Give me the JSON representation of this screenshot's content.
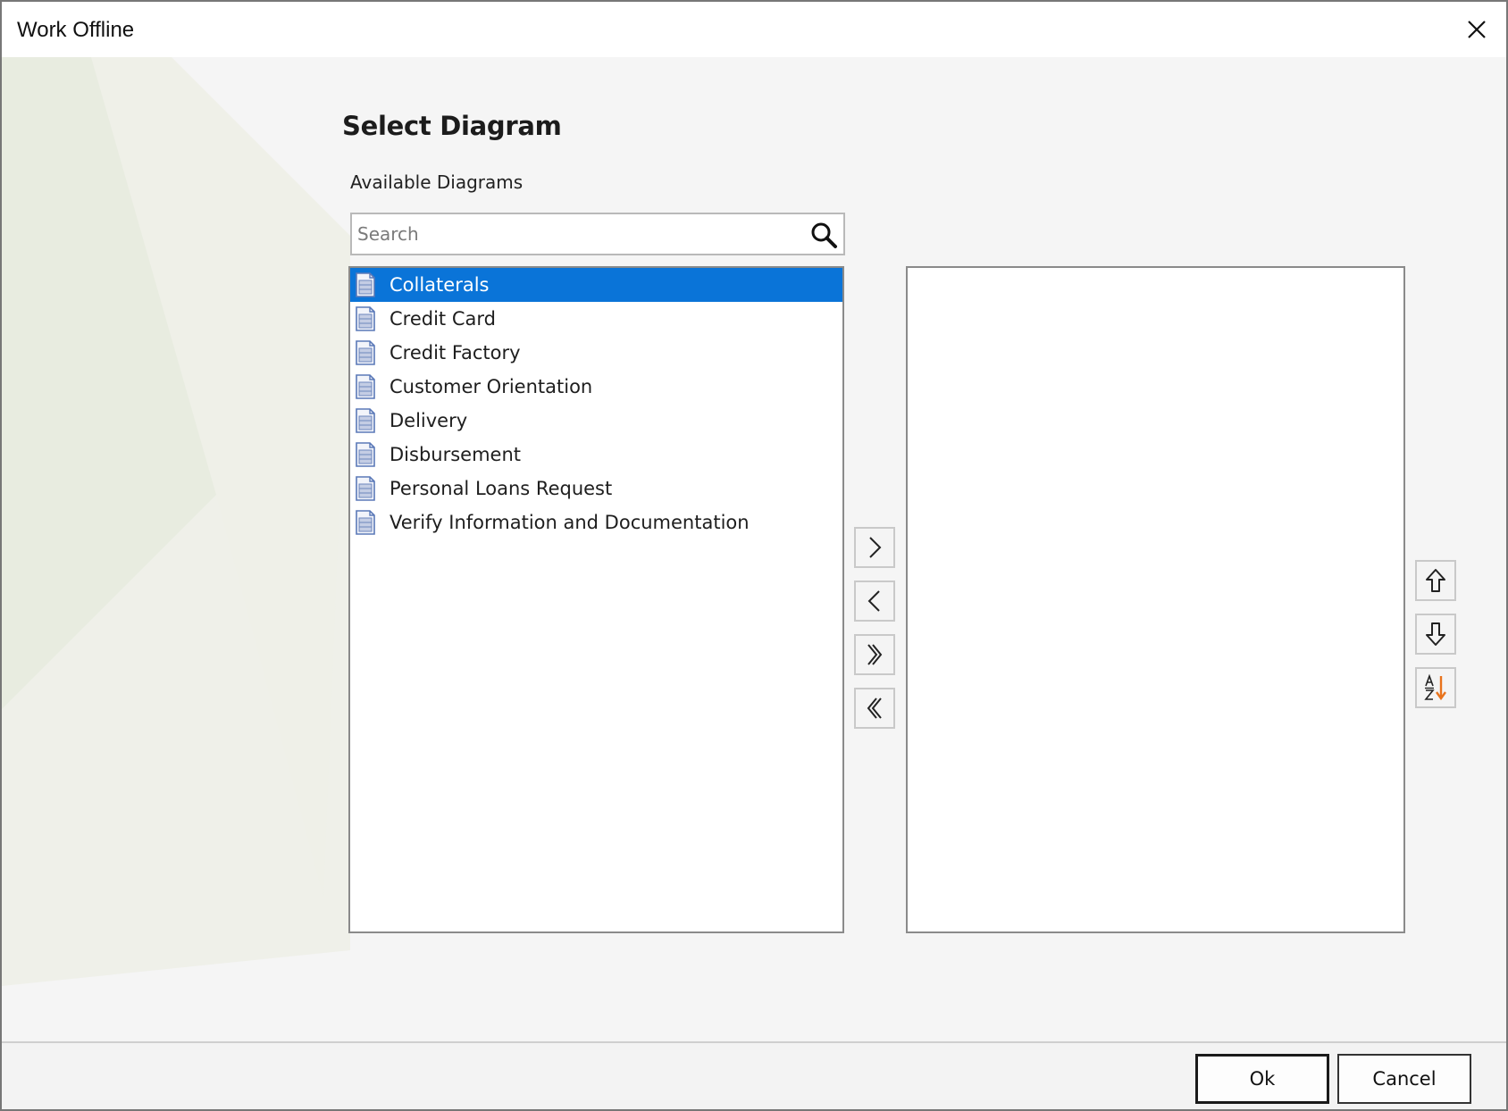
{
  "window": {
    "title": "Work Offline",
    "close_icon": "close-icon"
  },
  "dialog": {
    "heading": "Select Diagram",
    "available_label": "Available Diagrams",
    "search": {
      "placeholder": "Search",
      "value": ""
    },
    "available_items": [
      {
        "label": "Collaterals",
        "selected": true
      },
      {
        "label": "Credit Card",
        "selected": false
      },
      {
        "label": "Credit Factory",
        "selected": false
      },
      {
        "label": "Customer Orientation",
        "selected": false
      },
      {
        "label": "Delivery",
        "selected": false
      },
      {
        "label": "Disbursement",
        "selected": false
      },
      {
        "label": "Personal Loans Request",
        "selected": false
      },
      {
        "label": "Verify Information and Documentation",
        "selected": false
      }
    ],
    "selected_items": [],
    "transfer_buttons": [
      "move-right-icon",
      "move-left-icon",
      "move-all-right-icon",
      "move-all-left-icon"
    ],
    "order_buttons": [
      "move-up-icon",
      "move-down-icon",
      "sort-az-icon"
    ]
  },
  "footer": {
    "ok_label": "Ok",
    "cancel_label": "Cancel"
  },
  "colors": {
    "selection": "#0a74d8",
    "sort_arrow": "#e8731c",
    "icon_blue": "#5b79b8"
  }
}
